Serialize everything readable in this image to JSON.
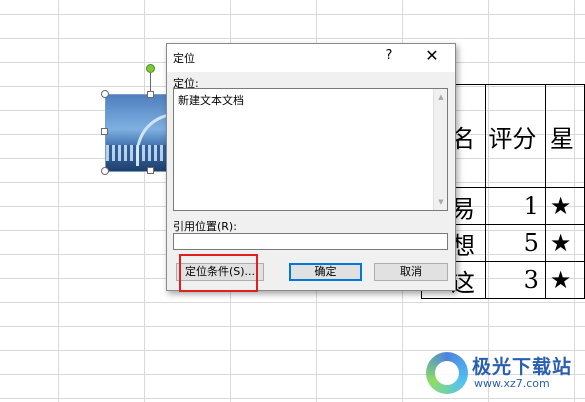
{
  "sheet": {
    "table": {
      "header": [
        "名",
        "评分",
        "星"
      ],
      "rows": [
        [
          "易",
          "1",
          "★"
        ],
        [
          "想",
          "5",
          "★"
        ],
        [
          "这",
          "3",
          "★"
        ]
      ]
    }
  },
  "dialog": {
    "title": "定位",
    "help_icon": "?",
    "close_icon": "✕",
    "goto_label": "定位:",
    "goto_items": [
      "新建文本文档"
    ],
    "scroll_up": "▲",
    "scroll_down": "▼",
    "reference_label": "引用位置(R):",
    "reference_value": "",
    "special_button": "定位条件(S)...",
    "ok_button": "确定",
    "cancel_button": "取消"
  },
  "watermark": {
    "name": "极光下载站",
    "url": "www.xz7.com"
  },
  "colors": {
    "highlight": "#e02020",
    "primary_button_border": "#0078d7",
    "rotate_handle": "#7acb3a"
  }
}
